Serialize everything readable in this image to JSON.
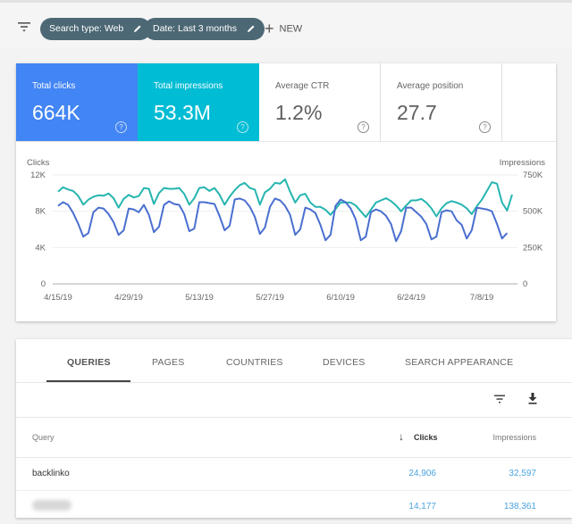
{
  "toolbar": {
    "filter_icon": "filter-list-icon",
    "chips": [
      {
        "label": "Search type: Web",
        "icon": "pencil-icon"
      },
      {
        "label": "Date: Last 3 months",
        "icon": "pencil-icon"
      }
    ],
    "new_label": "NEW",
    "new_icon": "plus-icon"
  },
  "metrics": [
    {
      "label": "Total clicks",
      "value": "664K",
      "color": "#4285f4",
      "selected": true
    },
    {
      "label": "Total impressions",
      "value": "53.3M",
      "color": "#00bcd4",
      "selected": true
    },
    {
      "label": "Average CTR",
      "value": "1.2%",
      "selected": false
    },
    {
      "label": "Average position",
      "value": "27.7",
      "selected": false
    }
  ],
  "help_glyph": "?",
  "chart_data": {
    "type": "line",
    "title": "",
    "y_left_label": "Clicks",
    "y_right_label": "Impressions",
    "y_left_ticks": [
      "0",
      "4K",
      "8K",
      "12K"
    ],
    "y_right_ticks": [
      "0",
      "250K",
      "500K",
      "750K"
    ],
    "ylim_left": [
      0,
      12000
    ],
    "ylim_right": [
      0,
      750000
    ],
    "x_tick_labels": [
      "4/15/19",
      "4/29/19",
      "5/13/19",
      "5/27/19",
      "6/10/19",
      "6/24/19",
      "7/8/19"
    ],
    "x_tick_day_index": [
      0,
      14,
      28,
      42,
      56,
      70,
      84
    ],
    "x_range_days": [
      0,
      90
    ],
    "grid": true,
    "series": [
      {
        "name": "Clicks",
        "axis": "left",
        "color": "#4a6fd0",
        "start_day": 0,
        "values": [
          8600,
          9000,
          8700,
          7800,
          6600,
          5200,
          5600,
          7900,
          8400,
          8300,
          7700,
          6800,
          5400,
          5900,
          8300,
          8200,
          7900,
          8700,
          7600,
          5700,
          6300,
          8700,
          9100,
          8800,
          8700,
          7700,
          5800,
          6100,
          9000,
          9000,
          8900,
          8800,
          7500,
          5900,
          6400,
          9300,
          9400,
          9200,
          8500,
          7400,
          5500,
          6200,
          8500,
          9400,
          9200,
          8600,
          7600,
          5400,
          6000,
          8400,
          8200,
          7800,
          6500,
          4800,
          5400,
          8600,
          9300,
          9000,
          8300,
          7100,
          4800,
          5200,
          7900,
          8200,
          8000,
          7500,
          6600,
          4700,
          5800,
          8400,
          8400,
          7900,
          7400,
          6600,
          4900,
          5200,
          7900,
          8100,
          8000,
          7000,
          6500,
          5000,
          5900,
          8400,
          8300,
          8200,
          8000,
          6600,
          5000,
          5600
        ]
      },
      {
        "name": "Impressions",
        "axis": "right",
        "color": "#26b5b0",
        "start_day": 0,
        "values": [
          635000,
          665000,
          650000,
          640000,
          605000,
          545000,
          580000,
          600000,
          610000,
          607000,
          622000,
          590000,
          525000,
          585000,
          613000,
          595000,
          605000,
          660000,
          655000,
          550000,
          625000,
          660000,
          655000,
          655000,
          660000,
          620000,
          545000,
          590000,
          660000,
          665000,
          640000,
          660000,
          615000,
          545000,
          600000,
          645000,
          680000,
          695000,
          660000,
          650000,
          545000,
          630000,
          655000,
          695000,
          690000,
          720000,
          635000,
          560000,
          610000,
          620000,
          560000,
          530000,
          530000,
          510000,
          475000,
          515000,
          560000,
          560000,
          560000,
          540000,
          500000,
          460000,
          510000,
          560000,
          575000,
          590000,
          570000,
          540000,
          500000,
          540000,
          575000,
          575000,
          585000,
          560000,
          520000,
          465000,
          520000,
          555000,
          570000,
          560000,
          545000,
          520000,
          480000,
          535000,
          580000,
          640000,
          700000,
          690000,
          560000,
          505000,
          615000
        ]
      }
    ]
  },
  "table": {
    "tabs": [
      {
        "label": "QUERIES",
        "active": true
      },
      {
        "label": "PAGES",
        "active": false
      },
      {
        "label": "COUNTRIES",
        "active": false
      },
      {
        "label": "DEVICES",
        "active": false
      },
      {
        "label": "SEARCH APPEARANCE",
        "active": false
      }
    ],
    "tool_icons": [
      "filter-list-icon",
      "download-icon"
    ],
    "columns": {
      "query": "Query",
      "clicks": "Clicks",
      "impressions": "Impressions",
      "sort_icon": "arrow-down-icon"
    },
    "rows": [
      {
        "query": "backlinko",
        "clicks": "24,906",
        "impressions": "32,597"
      },
      {
        "query": "blurred query",
        "clicks": "14,177",
        "impressions": "138,361",
        "blurred": true
      }
    ]
  }
}
